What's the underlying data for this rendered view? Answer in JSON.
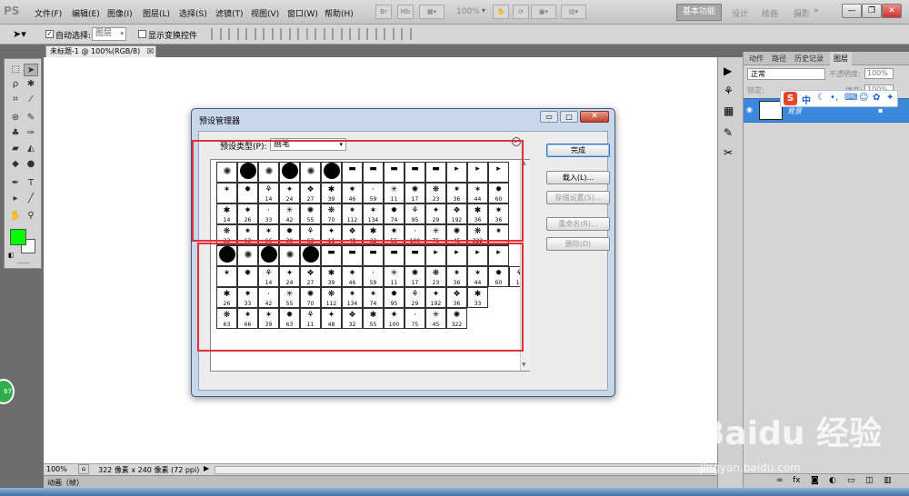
{
  "app": {
    "logo": "PS",
    "menus": [
      "文件(F)",
      "编辑(E)",
      "图像(I)",
      "图层(L)",
      "选择(S)",
      "滤镜(T)",
      "视图(V)",
      "窗口(W)",
      "帮助(H)"
    ],
    "zoom_menu": "100%",
    "workspace_active": "基本功能",
    "workspace_links": [
      "设计",
      "绘画",
      "摄影"
    ],
    "window_controls": [
      "—",
      "❐",
      "✕"
    ]
  },
  "options_bar": {
    "auto_select_label": "自动选择:",
    "auto_select_checked": true,
    "auto_select_value": "图层",
    "transform_controls_label": "显示变换控件"
  },
  "document": {
    "tab_title": "未标题-1 @ 100%(RGB/8)",
    "zoom": "100%",
    "doc_info": "322 像素 x 240 像素 (72 ppi)",
    "animation_label": "动画（帧）"
  },
  "colors": {
    "foreground": "#00ff00",
    "background": "#ffffff",
    "selection_box": "#e0303a",
    "layer_highlight": "#3b88dd"
  },
  "layers_panel": {
    "tabs": [
      "动作",
      "路径",
      "历史记录",
      "图层"
    ],
    "blend_mode": "正常",
    "opacity_label": "不透明度:",
    "opacity_value": "100%",
    "lock_label": "锁定:",
    "fill_label": "填充:",
    "fill_value": "100%",
    "layer_name": "背景",
    "ime_text": "中"
  },
  "dialog": {
    "title": "预设管理器",
    "preset_type_label": "预设类型(P):",
    "preset_type_value": "画笔",
    "buttons": {
      "done": "完成",
      "load": "载入(L)...",
      "save": "存储设置(S)...",
      "rename": "重命名(R)...",
      "delete": "删除(D)"
    },
    "top_grid_labels": [
      [
        "",
        "",
        "",
        "",
        "",
        "",
        "",
        "",
        "",
        "",
        "",
        "",
        "",
        ""
      ],
      [
        "",
        "",
        "14",
        "24",
        "27",
        "39",
        "46",
        "59",
        "11",
        "17",
        "23",
        "36",
        "44",
        "60"
      ],
      [
        "14",
        "26",
        "33",
        "42",
        "55",
        "70",
        "112",
        "134",
        "74",
        "95",
        "29",
        "192",
        "36",
        "36"
      ],
      [
        "33",
        "63",
        "66",
        "39",
        "63",
        "11",
        "48",
        "32",
        "55",
        "100",
        "75",
        "45",
        "322",
        ""
      ]
    ],
    "bottom_grid_labels": [
      [
        "",
        "",
        "",
        "",
        "",
        "",
        "",
        "",
        "",
        "",
        "",
        "",
        "",
        ""
      ],
      [
        "",
        "",
        "14",
        "24",
        "27",
        "39",
        "46",
        "59",
        "11",
        "17",
        "23",
        "36",
        "44",
        "60",
        "14"
      ],
      [
        "26",
        "33",
        "42",
        "55",
        "70",
        "112",
        "134",
        "74",
        "95",
        "29",
        "192",
        "36",
        "33"
      ],
      [
        "63",
        "66",
        "39",
        "63",
        "11",
        "48",
        "32",
        "55",
        "100",
        "75",
        "45",
        "322"
      ]
    ]
  },
  "badge": "67",
  "watermark": {
    "text": "Baidu 经验",
    "url": "jingyan.baidu.com"
  }
}
